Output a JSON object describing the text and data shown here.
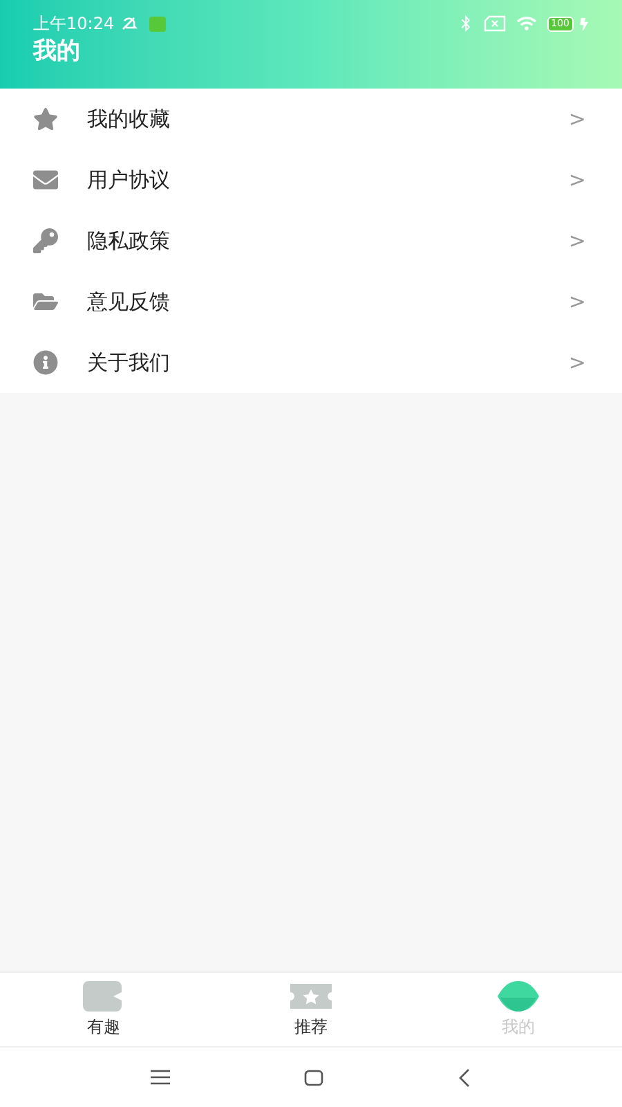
{
  "status_bar": {
    "time": "上午10:24",
    "battery": "100"
  },
  "header": {
    "title": "我的"
  },
  "menu": [
    {
      "label": "我的收藏",
      "chevron": ">"
    },
    {
      "label": "用户协议",
      "chevron": ">"
    },
    {
      "label": "隐私政策",
      "chevron": ">"
    },
    {
      "label": "意见反馈",
      "chevron": ">"
    },
    {
      "label": "关于我们",
      "chevron": ">"
    }
  ],
  "tabs": [
    {
      "label": "有趣",
      "selected": false
    },
    {
      "label": "推荐",
      "selected": false
    },
    {
      "label": "我的",
      "selected": true
    }
  ]
}
